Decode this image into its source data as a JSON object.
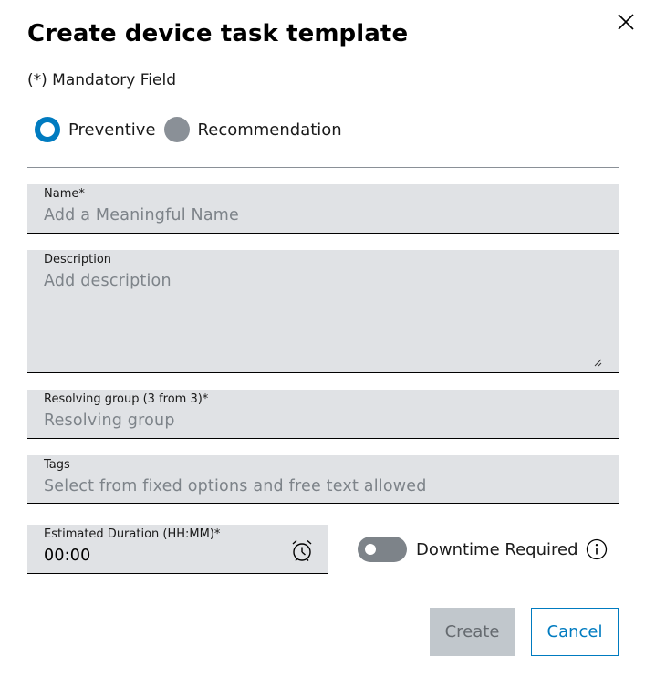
{
  "dialog": {
    "title": "Create device task template",
    "mandatory_note": "(*) Mandatory Field"
  },
  "task_type": {
    "options": [
      {
        "label": "Preventive",
        "selected": true
      },
      {
        "label": "Recommendation",
        "selected": false
      }
    ]
  },
  "form": {
    "name": {
      "label": "Name*",
      "placeholder": "Add a Meaningful Name"
    },
    "description": {
      "label": "Description",
      "placeholder": "Add description"
    },
    "resolving_group": {
      "label": "Resolving group (3 from 3)*",
      "placeholder": "Resolving group"
    },
    "tags": {
      "label": "Tags",
      "placeholder": "Select from fixed options and free text allowed"
    },
    "estimated_duration": {
      "label": "Estimated Duration (HH:MM)*",
      "value": "00:00"
    },
    "downtime_required": {
      "label": "Downtime Required",
      "enabled": false
    }
  },
  "actions": {
    "create_label": "Create",
    "cancel_label": "Cancel"
  },
  "colors": {
    "accent": "#007bc0",
    "field_background": "#e0e2e5",
    "disabled_button": "#c1c7cc",
    "toggle_off": "#7d8389"
  },
  "icons": {
    "close": "close-icon",
    "clock": "clock-icon",
    "info": "info-icon",
    "resize": "resize-handle-icon"
  }
}
